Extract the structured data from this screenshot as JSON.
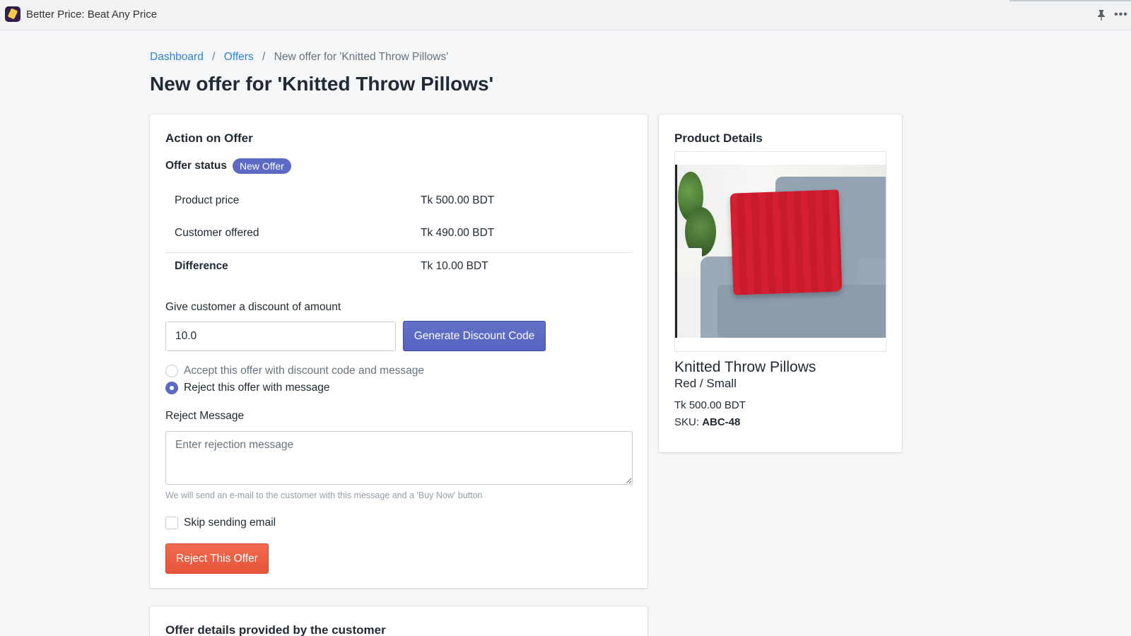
{
  "app": {
    "title": "Better Price: Beat Any Price",
    "icons": {
      "app": "price-tag-icon",
      "pin": "pin-icon",
      "more": "more-icon"
    },
    "more_glyph": "•••"
  },
  "breadcrumb": {
    "items": [
      {
        "label": "Dashboard"
      },
      {
        "label": "Offers"
      }
    ],
    "current": "New offer for 'Knitted Throw Pillows'",
    "separator": "/"
  },
  "page": {
    "title": "New offer for 'Knitted Throw Pillows'"
  },
  "action_card": {
    "heading": "Action on Offer",
    "status_label": "Offer status",
    "status_badge": "New Offer",
    "rows": [
      {
        "label": "Product price",
        "value": "Tk 500.00 BDT"
      },
      {
        "label": "Customer offered",
        "value": "Tk 490.00 BDT"
      },
      {
        "label": "Difference",
        "value": "Tk 10.00 BDT"
      }
    ],
    "discount_label": "Give customer a discount of amount",
    "discount_value": "10.0",
    "generate_button": "Generate Discount Code",
    "options": [
      {
        "label": "Accept this offer with discount code and message",
        "checked": false
      },
      {
        "label": "Reject this offer with message",
        "checked": true
      }
    ],
    "reject_message_label": "Reject Message",
    "reject_message_placeholder": "Enter rejection message",
    "reject_message_value": "",
    "help_text": "We will send an e-mail to the customer with this message and a 'Buy Now' button",
    "skip_email_label": "Skip sending email",
    "skip_email_checked": false,
    "reject_button": "Reject This Offer"
  },
  "product_card": {
    "heading": "Product Details",
    "image_alt": "Red knitted throw pillow on grey armchair",
    "name": "Knitted Throw Pillows",
    "variant": "Red / Small",
    "price": "Tk 500.00 BDT",
    "sku_label": "SKU:",
    "sku": "ABC-48"
  },
  "details_card": {
    "heading": "Offer details provided by the customer"
  },
  "colors": {
    "primary": "#5c6ac4",
    "danger": "#e6553a",
    "link": "#2c85d6",
    "background": "#f4f6f8"
  }
}
